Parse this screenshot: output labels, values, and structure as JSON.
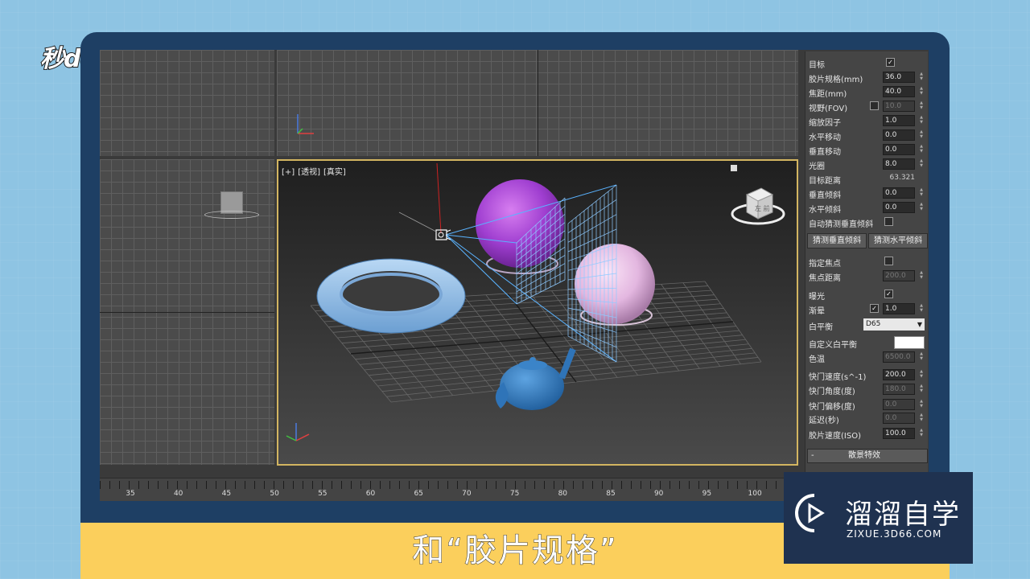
{
  "brand": {
    "logo_text": "秒dong视频"
  },
  "subtitle": {
    "text": "和“胶片规格”"
  },
  "watermark": {
    "title": "溜溜自学",
    "url": "ZIXUE.3D66.COM"
  },
  "viewport": {
    "labels": [
      "[+]",
      "[透视]",
      "[真实]"
    ],
    "viewcube_label": "左 前"
  },
  "timeline": {
    "ticks": [
      "35",
      "40",
      "45",
      "50",
      "55",
      "60",
      "65",
      "70",
      "75",
      "80",
      "85",
      "90",
      "95",
      "100"
    ]
  },
  "panel": {
    "target_label": "目标",
    "target_checked": "✓",
    "film_label": "胶片规格(mm)",
    "film_value": "36.0",
    "focal_label": "焦距(mm)",
    "focal_value": "40.0",
    "fov_label": "视野(FOV)",
    "fov_value": "10.0",
    "zoom_label": "缩放因子",
    "zoom_value": "1.0",
    "hshift_label": "水平移动",
    "hshift_value": "0.0",
    "vshift_label": "垂直移动",
    "vshift_value": "0.0",
    "aperture_label": "光圈",
    "aperture_value": "8.0",
    "target_dist_label": "目标距离",
    "target_dist_value": "63.321",
    "vtilt_label": "垂直倾斜",
    "vtilt_value": "0.0",
    "htilt_label": "水平倾斜",
    "htilt_value": "0.0",
    "auto_vtilt_label": "自动猜测垂直倾斜",
    "guess_v_button": "猜测垂直倾斜",
    "guess_h_button": "猜测水平倾斜",
    "specify_focus_label": "指定焦点",
    "focus_dist_label": "焦点距离",
    "focus_dist_value": "200.0",
    "exposure_label": "曝光",
    "exposure_checked": "✓",
    "vignette_label": "渐晕",
    "vignette_checked": "✓",
    "vignette_value": "1.0",
    "wb_label": "白平衡",
    "wb_value": "D65",
    "custom_wb_label": "自定义白平衡",
    "temp_label": "色温",
    "temp_value": "6500.0",
    "shutter_label": "快门速度(s^-1)",
    "shutter_value": "200.0",
    "shutter_angle_label": "快门角度(度)",
    "shutter_angle_value": "180.0",
    "shutter_offset_label": "快门偏移(度)",
    "shutter_offset_value": "0.0",
    "latency_label": "延迟(秒)",
    "latency_value": "0.0",
    "iso_label": "胶片速度(ISO)",
    "iso_value": "100.0",
    "bokeh_rollout_sign": "-",
    "bokeh_rollout_title": "散景特效"
  }
}
